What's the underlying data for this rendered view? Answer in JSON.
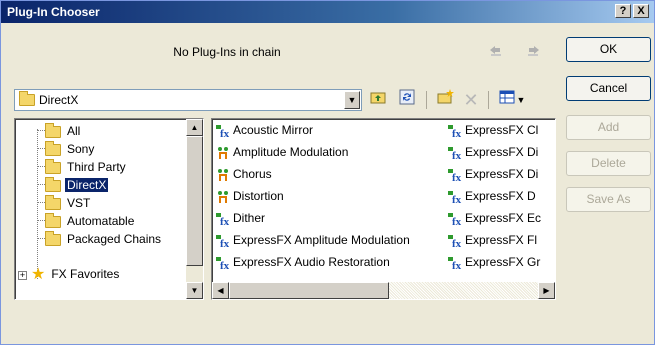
{
  "window": {
    "title": "Plug-In Chooser",
    "help_label": "?",
    "close_label": "X"
  },
  "chain": {
    "status_text": "No Plug-Ins in chain"
  },
  "buttons": {
    "ok": "OK",
    "cancel": "Cancel",
    "add": "Add",
    "delete": "Delete",
    "save_as": "Save As"
  },
  "folder_combo": {
    "selected": "DirectX"
  },
  "toolbar": {
    "icons": [
      "folder-up-icon",
      "refresh-icon",
      "new-folder-icon",
      "delete-icon",
      "view-icon"
    ]
  },
  "tree": {
    "items": [
      {
        "label": "All",
        "icon": "folder-icon"
      },
      {
        "label": "Sony",
        "icon": "folder-icon"
      },
      {
        "label": "Third Party",
        "icon": "folder-icon"
      },
      {
        "label": "DirectX",
        "icon": "folder-icon",
        "selected": true
      },
      {
        "label": "VST",
        "icon": "folder-icon"
      },
      {
        "label": "Automatable",
        "icon": "folder-icon"
      },
      {
        "label": "Packaged Chains",
        "icon": "folder-icon"
      },
      {
        "label": "FX Favorites",
        "icon": "star-icon",
        "expandable": true
      }
    ],
    "expander_label": "+"
  },
  "plugins": {
    "column1": [
      {
        "label": "Acoustic Mirror",
        "icon": "plugin-icon"
      },
      {
        "label": "Amplitude Modulation",
        "icon": "plugin-chain-icon"
      },
      {
        "label": "Chorus",
        "icon": "plugin-chain-icon"
      },
      {
        "label": "Distortion",
        "icon": "plugin-chain-icon"
      },
      {
        "label": "Dither",
        "icon": "plugin-icon"
      },
      {
        "label": "ExpressFX Amplitude Modulation",
        "icon": "plugin-icon"
      },
      {
        "label": "ExpressFX Audio Restoration",
        "icon": "plugin-icon"
      }
    ],
    "column2": [
      {
        "label": "ExpressFX Cl",
        "icon": "plugin-icon"
      },
      {
        "label": "ExpressFX Di",
        "icon": "plugin-icon"
      },
      {
        "label": "ExpressFX Di",
        "icon": "plugin-icon"
      },
      {
        "label": "ExpressFX D",
        "icon": "plugin-icon"
      },
      {
        "label": "ExpressFX Ec",
        "icon": "plugin-icon"
      },
      {
        "label": "ExpressFX Fl",
        "icon": "plugin-icon"
      },
      {
        "label": "ExpressFX Gr",
        "icon": "plugin-icon"
      }
    ]
  },
  "colors": {
    "title_bar": "#0a246a",
    "selection": "#0a246a",
    "plugin_icon_blue": "#1c4fb5",
    "plugin_icon_green": "#2e9a2e"
  }
}
